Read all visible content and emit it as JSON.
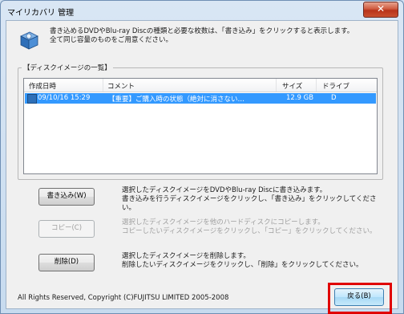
{
  "window": {
    "title": "マイリカバリ 管理",
    "close_symbol": "✕"
  },
  "intro": {
    "line1": "書き込めるDVDやBlu-ray Discの種類と必要な枚数は、「書き込み」をクリックすると表示します。",
    "line2": "全て同じ容量のものをご用意ください。"
  },
  "disk_list": {
    "group_label": "【ディスクイメージの一覧】",
    "columns": [
      "作成日時",
      "コメント",
      "サイズ",
      "ドライブ"
    ],
    "rows": [
      {
        "date": "09/10/16 15:29",
        "comment": "【重要】ご購入時の状態（絶対に消さない…",
        "size": "12.9 GB",
        "drive": "D"
      }
    ]
  },
  "actions": {
    "write": {
      "label": "書き込み(W)",
      "line1": "選択したディスクイメージをDVDやBlu-ray Discに書き込みます。",
      "line2": "書き込みを行うディスクイメージをクリックし、「書き込み」をクリックしてください。"
    },
    "copy": {
      "label": "コピー(C)",
      "line1": "選択したディスクイメージを他のハードディスクにコピーします。",
      "line2": "コピーしたいディスクイメージをクリックし、「コピー」をクリックしてください。"
    },
    "delete": {
      "label": "削除(D)",
      "line1": "選択したディスクイメージを削除します。",
      "line2": "削除したいディスクイメージをクリックし、「削除」をクリックしてください。"
    }
  },
  "footer": {
    "copyright": "All Rights Reserved, Copyright (C)FUJITSU LIMITED 2005-2008",
    "back_label": "戻る(B)"
  },
  "colors": {
    "selection": "#3399ff",
    "highlight_border": "#e00000"
  }
}
